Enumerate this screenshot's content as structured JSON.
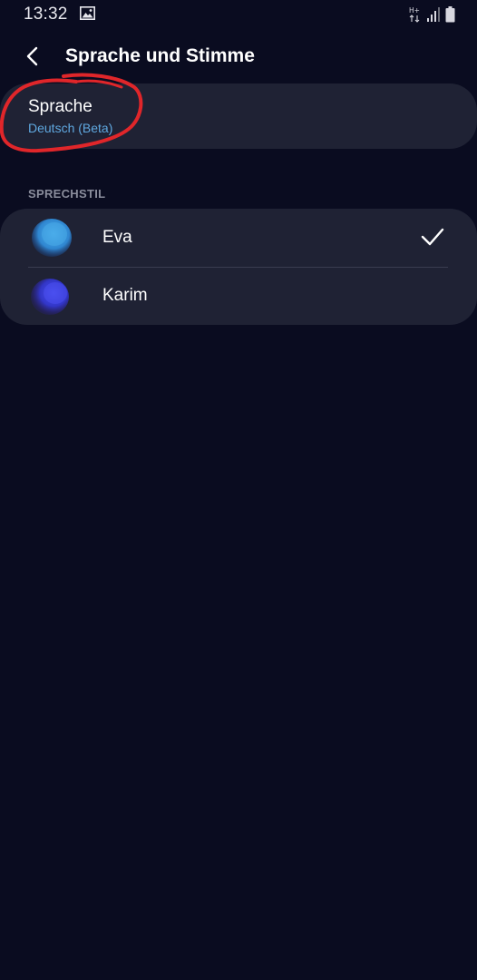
{
  "status_bar": {
    "time": "13:32",
    "icons": [
      "gallery-icon",
      "network-type-icon",
      "signal-icon",
      "battery-icon"
    ]
  },
  "header": {
    "title": "Sprache und Stimme",
    "back_icon": "chevron-left-icon"
  },
  "language": {
    "title": "Sprache",
    "value": "Deutsch (Beta)"
  },
  "voice_section": {
    "header": "SPRECHSTIL",
    "voices": [
      {
        "name": "Eva",
        "selected": true,
        "color": "#3a9be0"
      },
      {
        "name": "Karim",
        "selected": false,
        "color": "#3a3fd8"
      }
    ]
  },
  "colors": {
    "background": "#0a0c20",
    "card": "#1f2234",
    "accent_text": "#5fa8e0",
    "annotation": "#e0262a"
  }
}
